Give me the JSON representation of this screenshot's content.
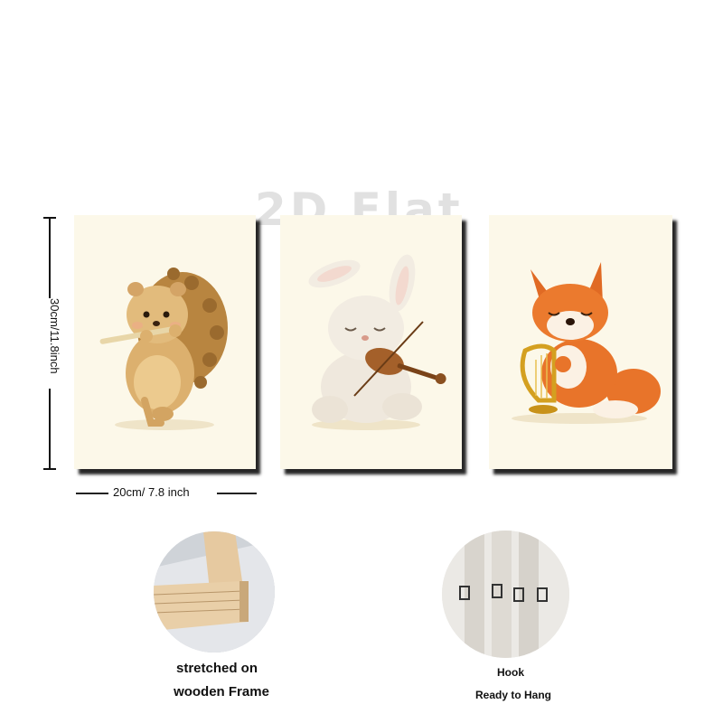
{
  "watermark": "2D Flat",
  "dimensions": {
    "height_label": "30cm/11.8inch",
    "width_label": "20cm/ 7.8 inch"
  },
  "paintings": [
    {
      "subject": "hedgehog",
      "instrument": "flute"
    },
    {
      "subject": "bunny",
      "instrument": "violin"
    },
    {
      "subject": "fox",
      "instrument": "harp"
    }
  ],
  "features": {
    "frame": {
      "line1": "stretched on",
      "line2": "wooden Frame"
    },
    "hook": {
      "line1": "Hook",
      "line2": "Ready to Hang"
    }
  },
  "colors": {
    "canvas_bg": "#fcf8e9",
    "fox_orange": "#e8742a",
    "hedgehog_tan": "#d8b070"
  }
}
